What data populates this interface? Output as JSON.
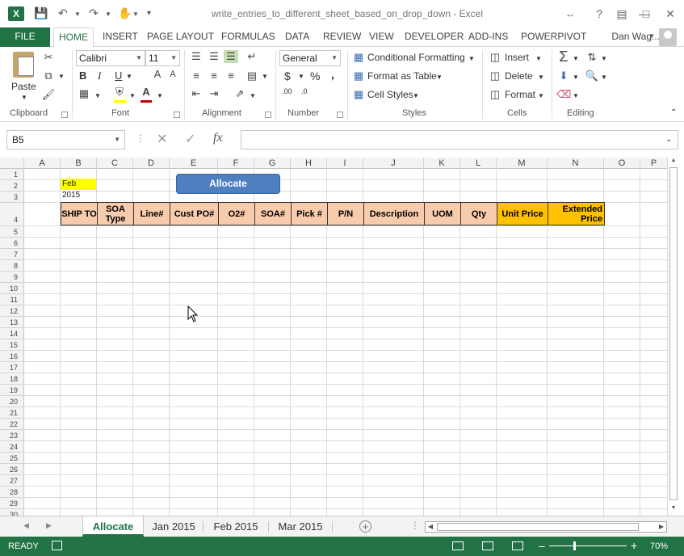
{
  "window": {
    "title": "write_entries_to_different_sheet_based_on_drop_down - Excel",
    "app_icon": "excel-icon"
  },
  "ribbon_tabs": [
    "FILE",
    "HOME",
    "INSERT",
    "PAGE LAYOUT",
    "FORMULAS",
    "DATA",
    "REVIEW",
    "VIEW",
    "DEVELOPER",
    "ADD-INS",
    "POWERPIVOT"
  ],
  "active_tab": "HOME",
  "user": {
    "name": "Dan Wag..."
  },
  "ribbon": {
    "clipboard": {
      "label": "Clipboard",
      "paste": "Paste"
    },
    "font": {
      "label": "Font",
      "family": "Calibri",
      "size": "11",
      "bold": "B",
      "italic": "I",
      "underline": "U"
    },
    "alignment": {
      "label": "Alignment"
    },
    "number": {
      "label": "Number",
      "format": "General",
      "currency": "$",
      "percent": "%",
      "comma": ",",
      "inc_decimal": ".00",
      "dec_decimal": ".0"
    },
    "styles": {
      "label": "Styles",
      "conditional": "Conditional Formatting",
      "format_table": "Format as Table",
      "cell_styles": "Cell Styles"
    },
    "cells": {
      "label": "Cells",
      "insert": "Insert",
      "delete": "Delete",
      "format": "Format"
    },
    "editing": {
      "label": "Editing"
    }
  },
  "formula_bar": {
    "name_box": "B5",
    "cancel": "✕",
    "enter": "✓",
    "fx": "fx",
    "value": ""
  },
  "columns": [
    "A",
    "B",
    "C",
    "D",
    "E",
    "F",
    "G",
    "H",
    "I",
    "J",
    "K",
    "L",
    "M",
    "N",
    "O",
    "P"
  ],
  "rows": [
    "1",
    "2",
    "3",
    "4",
    "5",
    "6",
    "7",
    "8",
    "9",
    "10",
    "11",
    "12",
    "13",
    "14",
    "15",
    "16",
    "17",
    "18",
    "19",
    "20",
    "21",
    "22",
    "23",
    "24",
    "25",
    "26",
    "27",
    "28",
    "29",
    "30"
  ],
  "sheet": {
    "date_cell": "Feb 2015",
    "button": "Allocate",
    "headers": [
      {
        "col": "B",
        "text": "SHIP TO"
      },
      {
        "col": "C",
        "text": "SOA Type"
      },
      {
        "col": "D",
        "text": "Line#"
      },
      {
        "col": "E",
        "text": "Cust PO#"
      },
      {
        "col": "F",
        "text": "O2#"
      },
      {
        "col": "G",
        "text": "SOA#"
      },
      {
        "col": "H",
        "text": "Pick  #"
      },
      {
        "col": "I",
        "text": "P/N"
      },
      {
        "col": "J",
        "text": "Description"
      },
      {
        "col": "K",
        "text": "UOM"
      },
      {
        "col": "L",
        "text": "Qty"
      },
      {
        "col": "M",
        "text": "Unit Price"
      },
      {
        "col": "N",
        "text": "Extended Price"
      }
    ]
  },
  "sheet_tabs": [
    "Allocate",
    "Jan 2015",
    "Feb 2015",
    "Mar 2015"
  ],
  "active_sheet": "Allocate",
  "status": {
    "mode": "READY",
    "zoom": "70%"
  },
  "colors": {
    "accent": "#217346",
    "header_fill": "#f8cbad",
    "header_orange": "#ffc000",
    "date_fill": "#ffff00",
    "button_fill": "#4e7fbf"
  }
}
